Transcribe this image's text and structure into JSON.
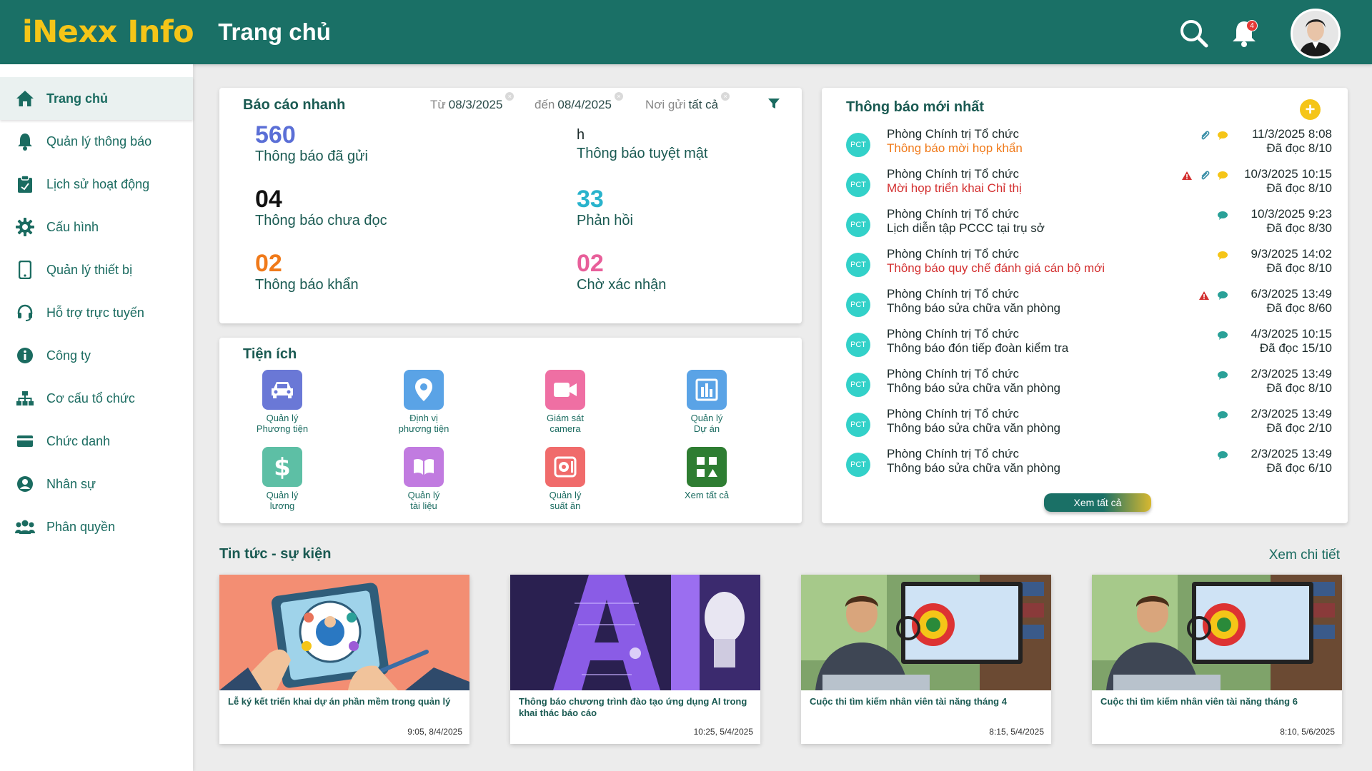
{
  "header": {
    "logo": "iNexx Info",
    "page_title": "Trang chủ",
    "notification_count": "4"
  },
  "sidebar": {
    "items": [
      {
        "label": "Trang chủ",
        "icon": "home-icon",
        "active": true
      },
      {
        "label": "Quản lý thông báo",
        "icon": "bell-icon"
      },
      {
        "label": "Lịch sử hoạt động",
        "icon": "clipboard-icon"
      },
      {
        "label": "Cấu hình",
        "icon": "gear-icon"
      },
      {
        "label": "Quản lý thiết bị",
        "icon": "phone-icon"
      },
      {
        "label": "Hỗ trợ trực tuyến",
        "icon": "headset-icon"
      },
      {
        "label": "Công ty",
        "icon": "info-icon"
      },
      {
        "label": "Cơ cấu tổ chức",
        "icon": "org-chart-icon"
      },
      {
        "label": "Chức danh",
        "icon": "card-icon"
      },
      {
        "label": "Nhân sự",
        "icon": "person-icon"
      },
      {
        "label": "Phân quyền",
        "icon": "people-icon"
      }
    ]
  },
  "quick_report": {
    "title": "Báo cáo nhanh",
    "filters": [
      {
        "label": "Từ",
        "value": "08/3/2025"
      },
      {
        "label": "đến",
        "value": "08/4/2025"
      },
      {
        "label": "Nơi gửi",
        "value": "tất cả"
      }
    ],
    "stats": [
      {
        "value": "560",
        "label": "Thông báo đã gửi",
        "color": "#5b6fd6"
      },
      {
        "value": "h",
        "label": "Thông báo tuyệt mật",
        "color": "#1c2b2b"
      },
      {
        "value": "04",
        "label": "Thông báo chưa đọc",
        "color": "#111111"
      },
      {
        "value": "33",
        "label": "Phản hồi",
        "color": "#29b3cc"
      },
      {
        "value": "02",
        "label": "Thông báo khẩn",
        "color": "#f07a1a"
      },
      {
        "value": "02",
        "label": "Chờ xác nhận",
        "color": "#e85f9a"
      }
    ]
  },
  "utilities": {
    "title": "Tiện ích",
    "items": [
      {
        "label1": "Quản lý",
        "label2": "Phương tiện",
        "icon": "car-icon",
        "color": "#6a78d6"
      },
      {
        "label1": "Định vị",
        "label2": "phương tiện",
        "icon": "location-pin-icon",
        "color": "#5aa3e6"
      },
      {
        "label1": "Giám sát",
        "label2": "camera",
        "icon": "camera-icon",
        "color": "#ef6fa3"
      },
      {
        "label1": "Quản lý",
        "label2": "Dự án",
        "icon": "bar-chart-icon",
        "color": "#5aa3e6"
      },
      {
        "label1": "Quản lý",
        "label2": "lương",
        "icon": "dollar-icon",
        "color": "#5dbfa5"
      },
      {
        "label1": "Quản lý",
        "label2": "tài liệu",
        "icon": "book-icon",
        "color": "#c17be0"
      },
      {
        "label1": "Quản lý",
        "label2": "suất ăn",
        "icon": "meal-icon",
        "color": "#f06b6b"
      },
      {
        "label1": "Xem tất cả",
        "label2": "",
        "icon": "grid-icon",
        "color": "#2e7d32"
      }
    ]
  },
  "latest": {
    "title": "Thông báo mới nhất",
    "avatar_text": "PCT",
    "see_all": "Xem tất cả",
    "items": [
      {
        "sender": "Phòng Chính trị Tổ chức",
        "subject": "Thông báo mời họp khẩn",
        "subject_color": "#f07a1a",
        "date": "11/3/2025 8:08",
        "read": "Đã đọc 8/10",
        "warn": false,
        "clip": true,
        "chat_color": "#f5c518"
      },
      {
        "sender": "Phòng Chính trị Tổ chức",
        "subject": "Mời họp triển khai Chỉ thị",
        "subject_color": "#d32f2f",
        "date": "10/3/2025 10:15",
        "read": "Đã đọc 8/10",
        "warn": true,
        "clip": true,
        "chat_color": "#f5c518"
      },
      {
        "sender": "Phòng Chính trị Tổ chức",
        "subject": "Lịch diễn tập PCCC tại trụ sở",
        "subject_color": "#1c2b2b",
        "date": "10/3/2025 9:23",
        "read": "Đã đọc 8/30",
        "warn": false,
        "clip": false,
        "chat_color": "#2aa198"
      },
      {
        "sender": "Phòng Chính trị Tổ chức",
        "subject": "Thông báo quy chế đánh giá cán bộ mới",
        "subject_color": "#d32f2f",
        "date": "9/3/2025 14:02",
        "read": "Đã đọc 8/10",
        "warn": false,
        "clip": false,
        "chat_color": "#f5c518"
      },
      {
        "sender": "Phòng Chính trị Tổ chức",
        "subject": "Thông báo sửa chữa văn phòng",
        "subject_color": "#1c2b2b",
        "date": "6/3/2025 13:49",
        "read": "Đã đọc 8/60",
        "warn": true,
        "clip": false,
        "chat_color": "#2aa198"
      },
      {
        "sender": "Phòng Chính trị Tổ chức",
        "subject": "Thông báo đón tiếp đoàn kiểm tra",
        "subject_color": "#1c2b2b",
        "date": "4/3/2025 10:15",
        "read": "Đã đọc 15/10",
        "warn": false,
        "clip": false,
        "chat_color": "#2aa198"
      },
      {
        "sender": "Phòng Chính trị Tổ chức",
        "subject": "Thông báo sửa chữa văn phòng",
        "subject_color": "#1c2b2b",
        "date": "2/3/2025 13:49",
        "read": "Đã đọc 8/10",
        "warn": false,
        "clip": false,
        "chat_color": "#2aa198"
      },
      {
        "sender": "Phòng Chính trị Tổ chức",
        "subject": "Thông báo sửa chữa văn phòng",
        "subject_color": "#1c2b2b",
        "date": "2/3/2025 13:49",
        "read": "Đã đọc 2/10",
        "warn": false,
        "clip": false,
        "chat_color": "#2aa198"
      },
      {
        "sender": "Phòng Chính trị Tổ chức",
        "subject": "Thông báo sửa chữa văn phòng",
        "subject_color": "#1c2b2b",
        "date": "2/3/2025 13:49",
        "read": "Đã đọc 6/10",
        "warn": false,
        "clip": false,
        "chat_color": "#2aa198"
      }
    ]
  },
  "news": {
    "title": "Tin tức - sự kiện",
    "more": "Xem chi tiết",
    "items": [
      {
        "caption": "Lễ ký kết triển khai dự án phần mềm trong quản lý",
        "time": "9:05, 8/4/2025"
      },
      {
        "caption": "Thông báo chương trình đào tạo ứng dụng AI trong khai thác báo cáo",
        "time": "10:25, 5/4/2025"
      },
      {
        "caption": "Cuộc thi tìm kiếm nhân viên tài năng tháng 4",
        "time": "8:15, 5/4/2025"
      },
      {
        "caption": "Cuộc thi tìm kiếm nhân viên tài năng tháng 6",
        "time": "8:10, 5/6/2025"
      }
    ]
  }
}
